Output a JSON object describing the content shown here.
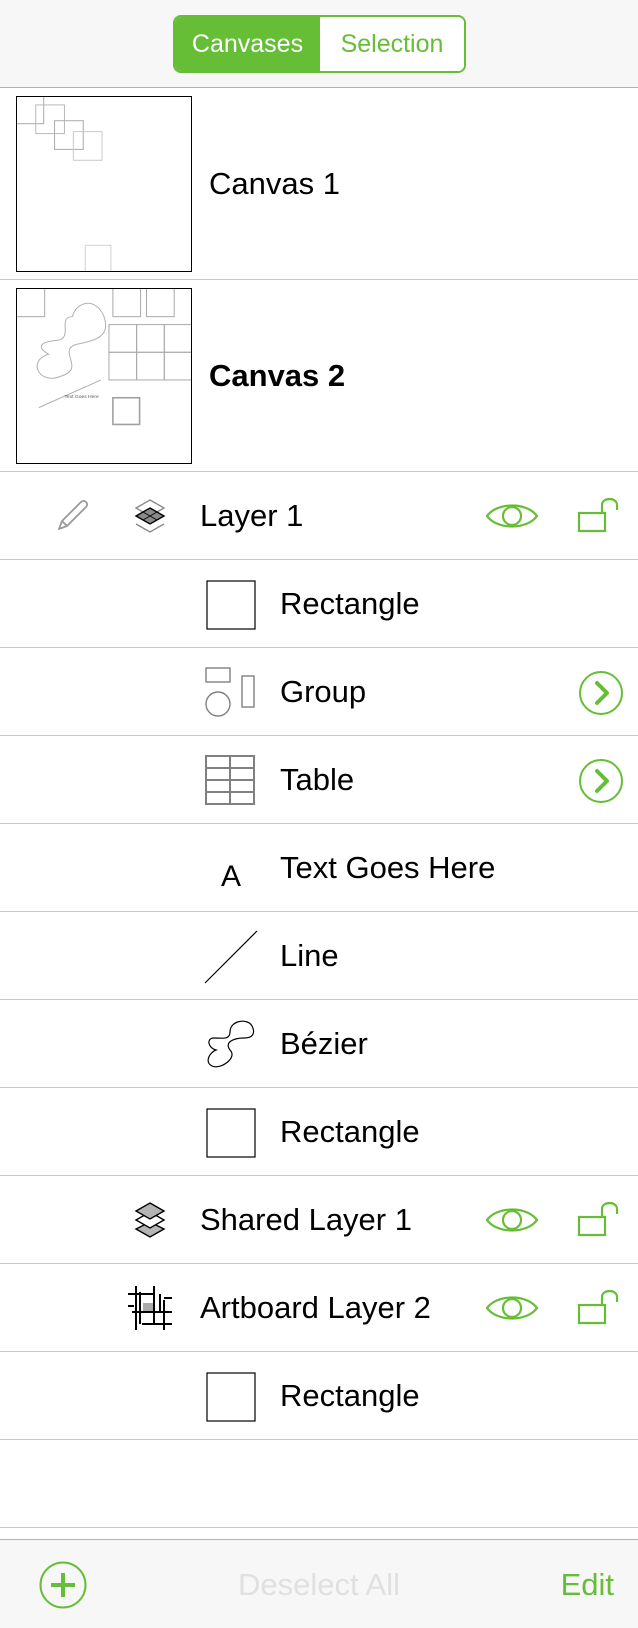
{
  "colors": {
    "accent": "#65be36",
    "separator": "#c8c8c8",
    "bar_background": "#f7f7f7",
    "disabled_text": "#e0e0e0",
    "icon_gray": "#808080"
  },
  "segmented_control": {
    "options": [
      "Canvases",
      "Selection"
    ],
    "selected": "Canvases"
  },
  "canvases": [
    {
      "name": "Canvas 1",
      "selected": false
    },
    {
      "name": "Canvas 2",
      "selected": true
    }
  ],
  "canvas_2_thumbnail_text": "Text Goes Here",
  "layers": [
    {
      "name": "Layer 1",
      "type": "layer",
      "icon": "layers-icon",
      "editing": true,
      "visible": true,
      "locked": false,
      "objects": [
        {
          "name": "Rectangle",
          "icon": "rectangle-icon",
          "has_disclosure": false
        },
        {
          "name": "Group",
          "icon": "group-icon",
          "has_disclosure": true
        },
        {
          "name": "Table",
          "icon": "table-icon",
          "has_disclosure": true
        },
        {
          "name": "Text Goes Here",
          "icon": "text-icon",
          "icon_glyph": "A",
          "has_disclosure": false
        },
        {
          "name": "Line",
          "icon": "line-icon",
          "has_disclosure": false
        },
        {
          "name": "Bézier",
          "icon": "bezier-icon",
          "has_disclosure": false
        },
        {
          "name": "Rectangle",
          "icon": "rectangle-icon",
          "has_disclosure": false
        }
      ]
    },
    {
      "name": "Shared Layer 1",
      "type": "shared-layer",
      "icon": "shared-layers-icon",
      "visible": true,
      "locked": false,
      "objects": []
    },
    {
      "name": "Artboard Layer 2",
      "type": "artboard-layer",
      "icon": "artboard-icon",
      "visible": true,
      "locked": false,
      "objects": [
        {
          "name": "Rectangle",
          "icon": "rectangle-icon",
          "has_disclosure": false
        }
      ]
    }
  ],
  "toolbar": {
    "add_icon": "plus-circle-icon",
    "deselect_label": "Deselect All",
    "deselect_enabled": false,
    "edit_label": "Edit"
  }
}
